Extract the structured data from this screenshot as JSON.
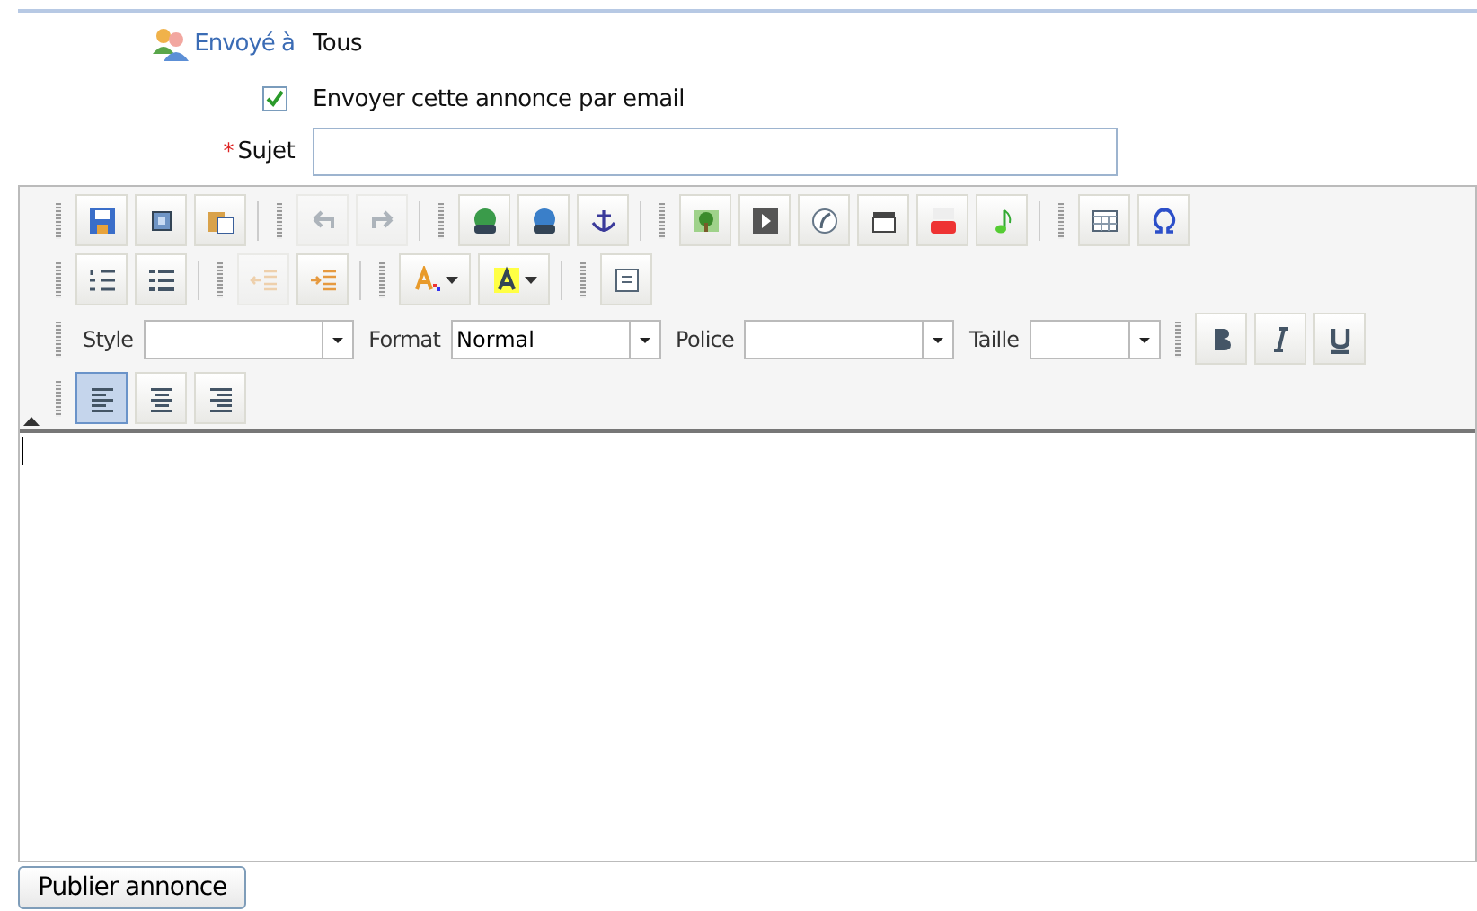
{
  "form": {
    "recipients": {
      "label": "Envoyé à",
      "value": "Tous"
    },
    "email": {
      "label": "Envoyer cette annonce par email",
      "checked": true
    },
    "subject": {
      "required_mark": "*",
      "label": "Sujet"
    }
  },
  "toolbar": {
    "rows": [
      {
        "groups": [
          [
            {
              "kind": "save",
              "disabled": false,
              "selected": false
            },
            {
              "kind": "preview",
              "disabled": false,
              "selected": false
            },
            {
              "kind": "paste-word",
              "disabled": false,
              "selected": false
            }
          ],
          [
            {
              "kind": "undo",
              "disabled": true,
              "selected": false
            },
            {
              "kind": "redo",
              "disabled": true,
              "selected": false
            }
          ],
          [
            {
              "kind": "link",
              "disabled": false,
              "selected": false
            },
            {
              "kind": "unlink",
              "disabled": false,
              "selected": false
            },
            {
              "kind": "anchor",
              "disabled": false,
              "selected": false
            }
          ],
          [
            {
              "kind": "image",
              "disabled": false,
              "selected": false
            },
            {
              "kind": "video",
              "disabled": false,
              "selected": false
            },
            {
              "kind": "flash",
              "disabled": false,
              "selected": false
            },
            {
              "kind": "clapper",
              "disabled": false,
              "selected": false
            },
            {
              "kind": "youtube",
              "disabled": false,
              "selected": false
            },
            {
              "kind": "music",
              "disabled": false,
              "selected": false
            }
          ],
          [
            {
              "kind": "table",
              "disabled": false,
              "selected": false
            },
            {
              "kind": "omega",
              "disabled": false,
              "selected": false
            }
          ]
        ]
      },
      {
        "groups": [
          [
            {
              "kind": "ordered-list",
              "disabled": false,
              "selected": false
            },
            {
              "kind": "bullet-list",
              "disabled": false,
              "selected": false
            }
          ],
          [
            {
              "kind": "outdent",
              "disabled": true,
              "selected": false
            },
            {
              "kind": "indent",
              "disabled": false,
              "selected": false
            }
          ],
          [
            {
              "kind": "text-color",
              "disabled": false,
              "selected": false
            },
            {
              "kind": "highlight",
              "disabled": false,
              "selected": false
            }
          ],
          [
            {
              "kind": "template",
              "disabled": false,
              "selected": false
            }
          ]
        ]
      }
    ],
    "selects": [
      {
        "label": "Style"
      },
      {
        "label": "Format",
        "value": "Normal"
      },
      {
        "label": "Police"
      },
      {
        "label": "Taille"
      }
    ],
    "styles": [
      {
        "kind": "bold",
        "disabled": false,
        "selected": false
      },
      {
        "kind": "italic",
        "disabled": false,
        "selected": false
      },
      {
        "kind": "underline",
        "disabled": false,
        "selected": false
      }
    ],
    "align": [
      {
        "kind": "align-left",
        "disabled": false,
        "selected": true
      },
      {
        "kind": "align-center",
        "disabled": false,
        "selected": false
      },
      {
        "kind": "align-right",
        "disabled": false,
        "selected": false
      }
    ]
  },
  "submit": {
    "label": "Publier annonce"
  }
}
